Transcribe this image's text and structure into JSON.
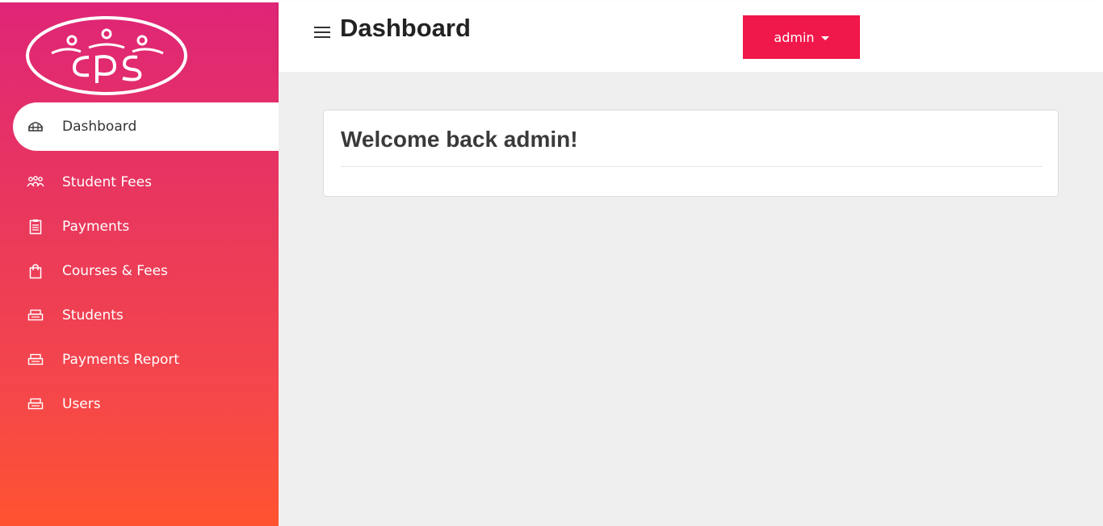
{
  "sidebar": {
    "logo_icon": "cps-logo",
    "items": [
      {
        "label": "Dashboard",
        "icon": "dashboard-icon",
        "active": true
      },
      {
        "label": "Student Fees",
        "icon": "users-group-icon",
        "active": false
      },
      {
        "label": "Payments",
        "icon": "clipboard-icon",
        "active": false
      },
      {
        "label": "Courses & Fees",
        "icon": "shopping-bag-icon",
        "active": false
      },
      {
        "label": "Students",
        "icon": "printer-icon",
        "active": false
      },
      {
        "label": "Payments Report",
        "icon": "printer-icon",
        "active": false
      },
      {
        "label": "Users",
        "icon": "printer-icon",
        "active": false
      }
    ]
  },
  "header": {
    "title": "Dashboard",
    "menu_icon": "hamburger-icon",
    "user_button": "admin"
  },
  "main": {
    "welcome": "Welcome back admin!"
  },
  "colors": {
    "sidebar_top": "#df2577",
    "sidebar_bottom": "#ff5330",
    "accent": "#f0184b",
    "background": "#efefef"
  }
}
